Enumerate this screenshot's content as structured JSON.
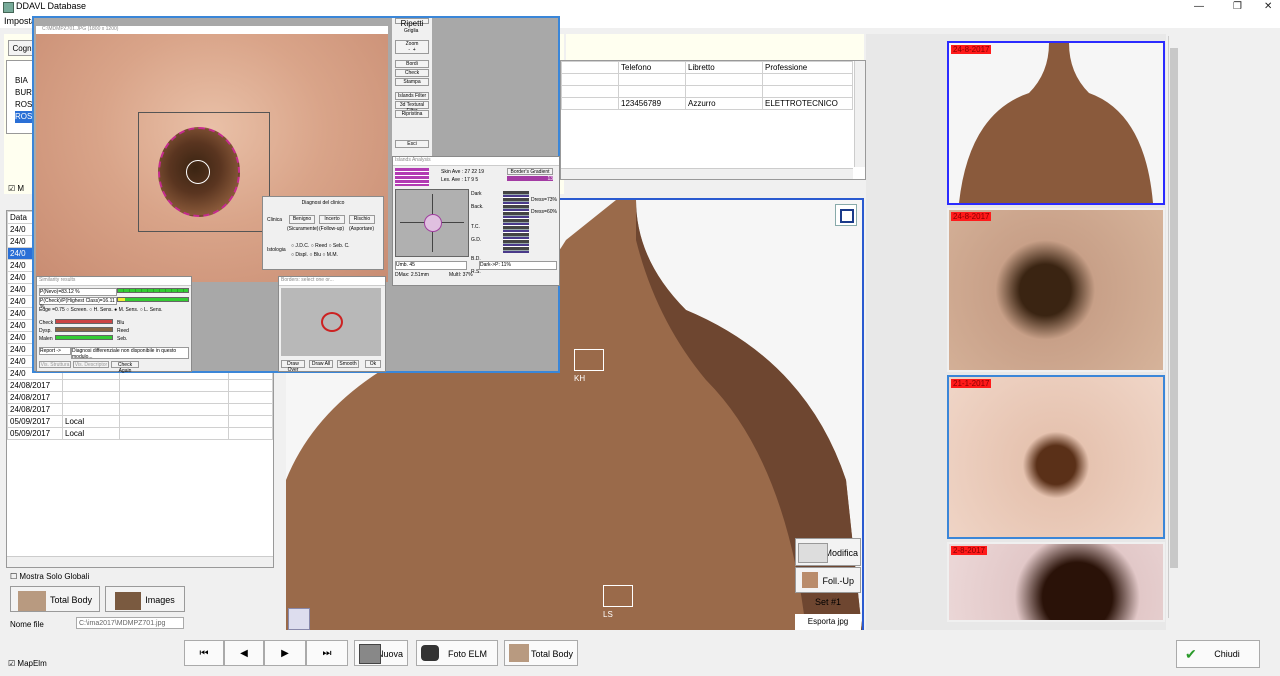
{
  "window": {
    "title": "DDAVL Database",
    "min": "—",
    "restore": "❐",
    "close": "✕"
  },
  "menu": {
    "item": "Imposta"
  },
  "patients": {
    "tab_label": "Cogn",
    "left_rows": [
      "BIA",
      "BUR",
      "ROS",
      "ROS"
    ],
    "columns": [
      "Telefono",
      "Libretto",
      "Professione"
    ],
    "row": {
      "telefono": "123456789",
      "libretto": "Azzurro",
      "professione": "ELETTROTECNICO"
    },
    "checkbox_label": "M"
  },
  "visits": {
    "header": "Data",
    "rows": [
      {
        "date": "24/0",
        "place": ""
      },
      {
        "date": "24/0",
        "place": ""
      },
      {
        "date": "24/0",
        "place": ""
      },
      {
        "date": "24/0",
        "place": ""
      },
      {
        "date": "24/0",
        "place": ""
      },
      {
        "date": "24/0",
        "place": ""
      },
      {
        "date": "24/0",
        "place": ""
      },
      {
        "date": "24/0",
        "place": ""
      },
      {
        "date": "24/0",
        "place": ""
      },
      {
        "date": "24/0",
        "place": ""
      },
      {
        "date": "24/0",
        "place": ""
      },
      {
        "date": "24/0",
        "place": ""
      },
      {
        "date": "24/0",
        "place": ""
      },
      {
        "date": "24/08/2017",
        "place": ""
      },
      {
        "date": "24/08/2017",
        "place": ""
      },
      {
        "date": "24/08/2017",
        "place": ""
      },
      {
        "date": "05/09/2017",
        "place": "Local"
      },
      {
        "date": "05/09/2017",
        "place": "Local"
      }
    ]
  },
  "left_controls": {
    "show_global": "Mostra Solo Globali",
    "total_body": "Total Body",
    "images": "Images",
    "filename_label": "Nome file",
    "filename_value": "C:\\ima2017\\MDMPZ701.jpg",
    "mapelm": "MapElm"
  },
  "viewer": {
    "marker_kh": "KH",
    "marker_ls": "LS",
    "modifica": "Modifica",
    "follow_up": "Foll.-Up",
    "set": "Set #1",
    "esporta": "Esporta jpg"
  },
  "elm_window": {
    "title": "C:\\MDMPZ701.JPG (1800 x 1200)",
    "side_buttons": [
      "Griglia",
      "Zoom",
      "Bordi",
      "Check",
      "Stampa",
      "Islands Filter",
      "3d Textural Filter",
      "Ripristina",
      "Esci"
    ],
    "side_top": "Ripetti",
    "zoom_minus": "-",
    "zoom_plus": "+"
  },
  "islands": {
    "title": "Islands Analysis",
    "skin": "Skin Ave : 27  22  19",
    "les": "Les. Ave : 17   9   5",
    "gradient_btn": "Border's Gradient",
    "gradient_val": "13",
    "labels": [
      "Dark",
      "Back.",
      "T.C.",
      "G.D.",
      "B.D.",
      "R.S."
    ],
    "right_vals": [
      "Dress=73%",
      "Dress=60%"
    ],
    "umb": "Umb.      45",
    "dark_p": "Dark->P:  11%",
    "dmax": "DMax:  2.51mm",
    "multi": "MultI:  37%"
  },
  "diagnosis": {
    "title": "Diagnosi del clinico",
    "clinica": "Clinica",
    "btns": [
      "Benigno",
      "Incerto",
      "Rischio"
    ],
    "sub": [
      "(Sicuramente)",
      "(Follow-up)",
      "(Asportare)"
    ],
    "istologia": "Istologia",
    "opts1": [
      "J.D.C.",
      "Reed",
      "Seb. C."
    ],
    "opts2": [
      "Displ.",
      "Blu",
      "M.M."
    ]
  },
  "similarity": {
    "title": "Similarity results",
    "line1": "P(Nevo)=83.12 %",
    "line2": "P(Check)/P(Highest Class)=16.11 %",
    "edge": "Edge",
    "edge_val": "=0.75",
    "radios": [
      "Screen.",
      "H. Sens.",
      "M. Sens.",
      "L. Sens."
    ],
    "rows": [
      "Check",
      "Dysp.",
      "Malen"
    ],
    "rows_r": [
      "Blu",
      "Reed",
      "Seb."
    ],
    "report": "Report ->",
    "report_text": "Diagnosi differenziale non disponibile in questo modulo...",
    "check_again": "Check Again",
    "vis1": "Vis. Struttura",
    "vis2": "Vis. Descriptor"
  },
  "borders": {
    "title": "Borders: select one or...",
    "btns": [
      "Draw Over",
      "Draw All",
      "Smooth",
      "Ok"
    ]
  },
  "nav": {
    "first": "⏮",
    "prev": "◀",
    "next": "▶",
    "last": "⏭",
    "nuova": "Nuova",
    "foto_elm": "Foto ELM",
    "total_body": "Total Body",
    "chiudi": "Chiudi"
  },
  "thumbs": [
    "24-8-2017",
    "24-8-2017",
    "21-1-2017",
    "2-8-2017"
  ]
}
